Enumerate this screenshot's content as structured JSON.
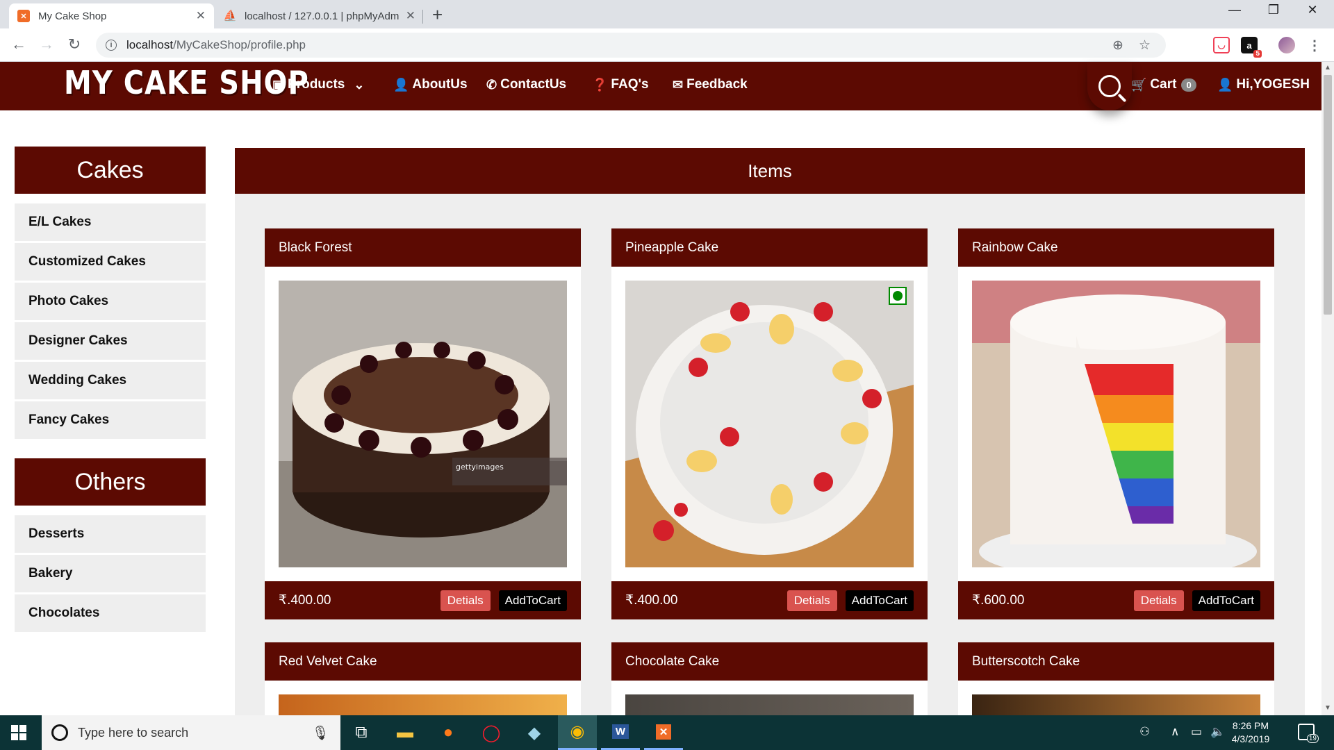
{
  "browser": {
    "tabs": [
      {
        "title": "My Cake Shop",
        "icon": "xampp-icon"
      },
      {
        "title": "localhost / 127.0.0.1 | phpMyAdm",
        "icon": "phpmyadmin-icon"
      }
    ],
    "url_host": "localhost",
    "url_path": "/MyCakeShop/profile.php"
  },
  "site": {
    "logo": "MY CAKE SHOP",
    "nav": {
      "products": "Products",
      "about": "AboutUs",
      "contact": "ContactUs",
      "faq": "FAQ's",
      "feedback": "Feedback",
      "cart": "Cart",
      "cart_count": "0",
      "user": "Hi,YOGESH"
    }
  },
  "sidebar": {
    "cakes_title": "Cakes",
    "cakes": [
      "E/L Cakes",
      "Customized Cakes",
      "Photo Cakes",
      "Designer Cakes",
      "Wedding Cakes",
      "Fancy Cakes"
    ],
    "others_title": "Others",
    "others": [
      "Desserts",
      "Bakery",
      "Chocolates"
    ]
  },
  "items": {
    "title": "Items",
    "details_label": "Detials",
    "add_label": "AddToCart",
    "products": [
      {
        "name": "Black Forest",
        "price": "₹.400.00"
      },
      {
        "name": "Pineapple Cake",
        "price": "₹.400.00"
      },
      {
        "name": "Rainbow Cake",
        "price": "₹.600.00"
      },
      {
        "name": "Red Velvet Cake",
        "price": ""
      },
      {
        "name": "Chocolate Cake",
        "price": ""
      },
      {
        "name": "Butterscotch Cake",
        "price": ""
      }
    ],
    "watermark": "gettyimages"
  },
  "taskbar": {
    "search_placeholder": "Type here to search",
    "time": "8:26 PM",
    "date": "4/3/2019",
    "notifications": "19"
  },
  "colors": {
    "brand": "#5c0a02",
    "details_button": "#d9534f",
    "taskbar": "#0c3336"
  }
}
